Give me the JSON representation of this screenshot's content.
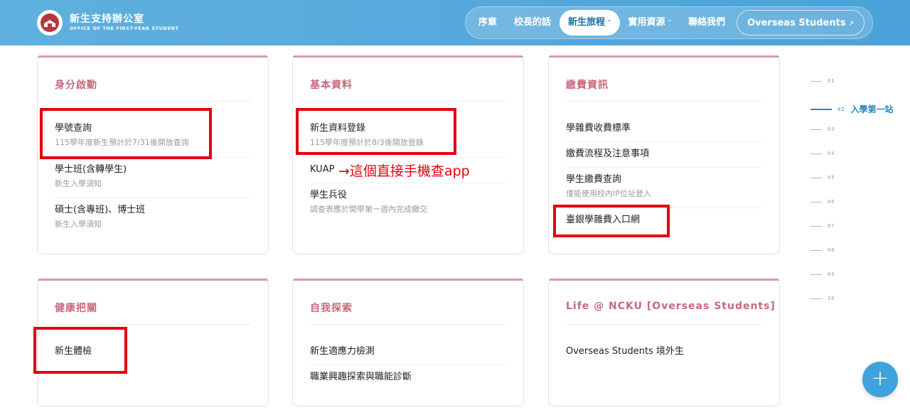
{
  "header": {
    "title": "新生支持辦公室",
    "subtitle": "OFFICE OF THE FIRST-YEAR STUDENT",
    "nav": [
      {
        "label": "序章"
      },
      {
        "label": "校長的話"
      },
      {
        "label": "新生旅程",
        "caret": "˅"
      },
      {
        "label": "實用資源",
        "caret": "˅"
      },
      {
        "label": "聯絡我們"
      },
      {
        "label": "Overseas Students",
        "caret": "↗"
      }
    ]
  },
  "cards": [
    {
      "title": "身分啟動",
      "items": [
        {
          "label": "學號查詢",
          "sub": "115學年度新生預計於7/31後開放查詢"
        },
        {
          "label": "學士班(含轉學生)",
          "sub": "新生入學須知"
        },
        {
          "label": "碩士(含專班)、博士班",
          "sub": "新生入學須知"
        }
      ]
    },
    {
      "title": "基本資料",
      "items": [
        {
          "label": "新生資料登錄",
          "sub": "115學年度預計於8/3後開放登錄"
        },
        {
          "label": "KUAP"
        },
        {
          "label": "學生兵役",
          "sub": "調查表應於開學第一週內完成繳交"
        }
      ]
    },
    {
      "title": "繳費資訊",
      "items": [
        {
          "label": "學雜費收費標準"
        },
        {
          "label": "繳費流程及注意事項"
        },
        {
          "label": "學生繳費查詢",
          "sub": "僅能使用校內IP位址登入"
        },
        {
          "label": "臺銀學雜費入口網"
        }
      ]
    },
    {
      "title": "健康把關",
      "items": [
        {
          "label": "新生體檢"
        }
      ]
    },
    {
      "title": "自我探索",
      "items": [
        {
          "label": "新生適應力檢測"
        },
        {
          "label": "職業興趣探索與職能診斷"
        }
      ]
    },
    {
      "title": "Life @ NCKU [Overseas Students]",
      "items": [
        {
          "label": "Overseas Students 境外生"
        }
      ]
    }
  ],
  "annotation": "→這個直接手機查app",
  "pager": {
    "items": [
      "01",
      "02",
      "03",
      "04",
      "05",
      "06",
      "07",
      "08",
      "09",
      "10"
    ],
    "active_index": 1,
    "active_label": "入學第一站"
  },
  "fab": {
    "icon": "plus-icon",
    "symbol": "+"
  },
  "colors": {
    "header": "#57a9dc",
    "accent_pink": "#c8687d",
    "highlight_red": "#e4000f",
    "pager_active": "#2b86c2"
  }
}
